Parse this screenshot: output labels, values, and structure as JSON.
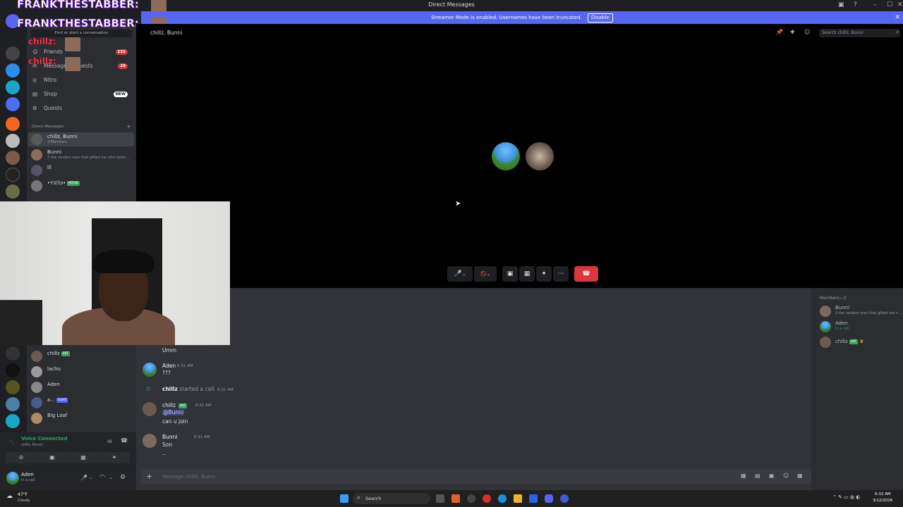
{
  "window": {
    "title": "Direct Messages",
    "controls": [
      "–",
      "☐",
      "✕"
    ]
  },
  "banner": {
    "text": "Streamer Mode is enabled. Usernames have been truncated.",
    "disable_label": "Disable"
  },
  "overlay": {
    "line1": "FRANKTHESTABBER:",
    "line2": "FRANKTHESTABBER:",
    "line3": "chillz:",
    "line4": "chillz:"
  },
  "dm_panel": {
    "search_placeholder": "Find or start a conversation",
    "nav": [
      {
        "label": "Friends",
        "icon": "friends-icon",
        "badge": "132"
      },
      {
        "label": "Message Requests",
        "icon": "message-request-icon",
        "badge": "29"
      },
      {
        "label": "Nitro",
        "icon": "nitro-icon",
        "badge": ""
      },
      {
        "label": "Shop",
        "icon": "shop-icon",
        "badge": "NEW"
      },
      {
        "label": "Quests",
        "icon": "quests-icon",
        "badge": ""
      }
    ],
    "dm_header": "Direct Messages",
    "add_dm": "+",
    "dms": [
      {
        "name": "chillz, Bunni",
        "sub": "3 Members"
      },
      {
        "name": "Bunni",
        "sub": "2 the random man that gifted me nitro tysm ..."
      },
      {
        "name": "lll",
        "sub": ""
      },
      {
        "name": "•Ƴ∂ℛ∂•",
        "sub": "MTHN"
      }
    ]
  },
  "call": {
    "header": "chillz, Bunni",
    "search_placeholder": "Search chillz, Bunni",
    "controls": [
      "🎤",
      "⌄",
      "🚫",
      "⌄",
      "▣",
      "▦",
      "✦",
      "⋯"
    ],
    "hangup": "☎"
  },
  "chat": {
    "messages": [
      {
        "type": "text_only",
        "text": "Umm"
      },
      {
        "type": "msg",
        "author": "Aden",
        "ts": "6:31 AM",
        "lines": [
          "???"
        ],
        "tag": ""
      },
      {
        "type": "system",
        "author": "chillz",
        "text": "started a call.",
        "ts": "6:31 AM"
      },
      {
        "type": "msg",
        "author": "chillz",
        "ts": "6:31 AM",
        "lines": [
          "@Bunni",
          "can u join"
        ],
        "tag": "4KT"
      },
      {
        "type": "msg",
        "author": "Bunni",
        "ts": "6:32 AM",
        "lines": [
          "Son",
          ".."
        ],
        "tag": ""
      }
    ],
    "composer_placeholder": "Message chillz, Bunni"
  },
  "members": {
    "header": "Members—3",
    "list": [
      {
        "name": "Bunni",
        "sub": "2 the random man that gifted me n..."
      },
      {
        "name": "Aden",
        "sub": "In a call"
      },
      {
        "name": "chillz",
        "sub": ""
      }
    ]
  },
  "lower_dm": [
    {
      "name": "chillz",
      "tag": "4KT"
    },
    {
      "name": "lachu",
      "tag": ""
    },
    {
      "name": "Aden",
      "tag": ""
    },
    {
      "name": "a...",
      "tag": "GOAT"
    },
    {
      "name": "Big Loaf",
      "tag": ""
    }
  ],
  "voice": {
    "status": "Voice Connected",
    "channel": "chillz, Bunni"
  },
  "user": {
    "name": "Aden",
    "status": "In a call"
  },
  "taskbar": {
    "weather_temp": "47°F",
    "weather_desc": "Cloudy",
    "search": "Search",
    "time": "6:32 AM",
    "date": "3/12/2026"
  },
  "colors": {
    "blurple": "#5865f2",
    "green": "#23a55a",
    "red": "#da373c",
    "dark": "#1e1f22"
  }
}
